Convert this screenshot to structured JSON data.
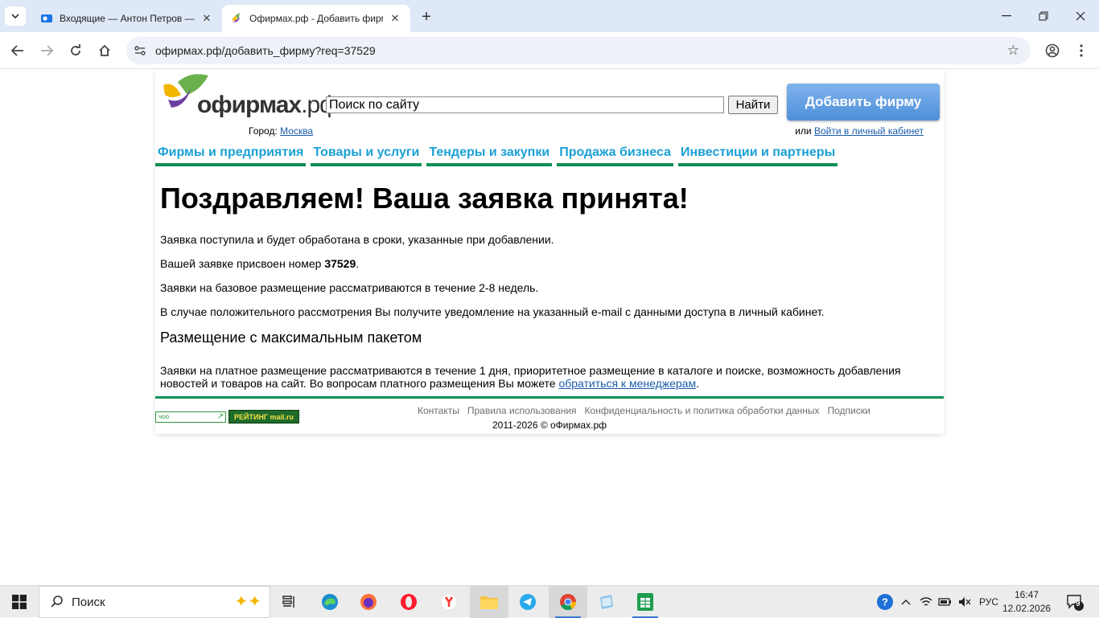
{
  "browser": {
    "tabs": [
      {
        "title": "Входящие — Антон Петров — ",
        "active": false
      },
      {
        "title": "Офирмах.рф - Добавить фирму",
        "active": true
      }
    ],
    "url": "офирмах.рф/добавить_фирму?req=37529"
  },
  "header": {
    "logo_text_bold": "офирмах",
    "logo_text_rest": ".рф",
    "search_placeholder": "Поиск по сайту",
    "search_button": "Найти",
    "add_firm_button": "Добавить фирму",
    "city_label": "Город:",
    "city_value": "Москва",
    "login_prefix": "или",
    "login_link": "Войти в личный кабинет"
  },
  "nav": {
    "items": [
      "Фирмы и предприятия",
      "Товары и услуги",
      "Тендеры и закупки",
      "Продажа бизнеса",
      "Инвестиции и партнеры"
    ]
  },
  "content": {
    "title": "Поздравляем! Ваша заявка принята!",
    "p1": "Заявка поступила и будет обработана в сроки, указанные при добавлении.",
    "p2_prefix": "Вашей заявке присвоен номер ",
    "request_number": "37529",
    "p2_suffix": ".",
    "p3": "Заявки на базовое размещение рассматриваются в течение 2-8 недель.",
    "p4": "В случае положительного рассмотрения Вы получите уведомление на указанный e-mail с данными доступа в личный кабинет.",
    "subtitle": "Размещение с максимальным пакетом",
    "p5": "Заявки на платное размещение рассматриваются в течение 1 дня, приоритетное размещение в каталоге и поиске, возможность добавления новостей и товаров на сайт. Во вопросам платного размещения Вы можете ",
    "p5_link": "обратиться к менеджерам",
    "p5_suffix": "."
  },
  "footer": {
    "counter1": "чоо",
    "counter2": "РЕЙТИНГ mail.ru",
    "links": [
      "Контакты",
      "Правила использования",
      "Конфиденциальность и политика обработки данных",
      "Подписки"
    ],
    "copyright": "2011-2026 © оФирмах.рф"
  },
  "taskbar": {
    "search_text": "Поиск",
    "lang": "РУС",
    "time": "16:47",
    "date": "12.02.2026",
    "notifications": "9"
  },
  "colors": {
    "nav_link": "#1ba0d6",
    "nav_underline": "#0f8f55",
    "add_button": "#5b9be0",
    "link": "#1a5cab"
  }
}
